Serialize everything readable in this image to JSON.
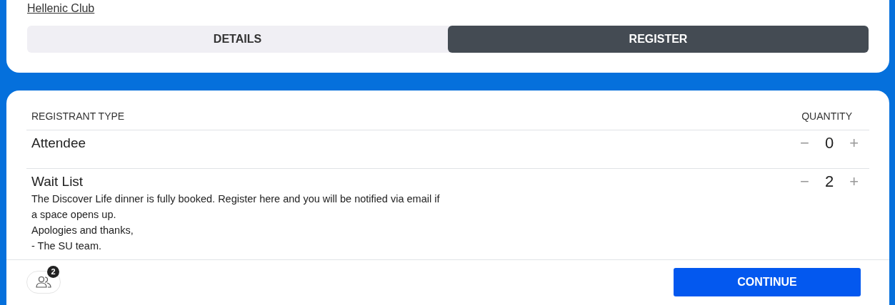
{
  "event_link": "Hellenic Club",
  "tabs": [
    {
      "label": "DETAILS",
      "selected": false
    },
    {
      "label": "REGISTER",
      "selected": true
    }
  ],
  "table": {
    "columns": [
      "REGISTRANT TYPE",
      "QUANTITY"
    ],
    "rows": [
      {
        "name": "Attendee",
        "description": [],
        "quantity": "0",
        "minus": "−",
        "plus": "+"
      },
      {
        "name": "Wait List",
        "description": [
          "The Discover Life dinner is fully booked. Register here and you will be notified via email if",
          "a space opens up.",
          "Apologies and thanks,",
          "- The SU team."
        ],
        "quantity": "2",
        "minus": "−",
        "plus": "+"
      }
    ]
  },
  "footer": {
    "attendee_count": "2",
    "continue_button": "CONTINUE"
  }
}
